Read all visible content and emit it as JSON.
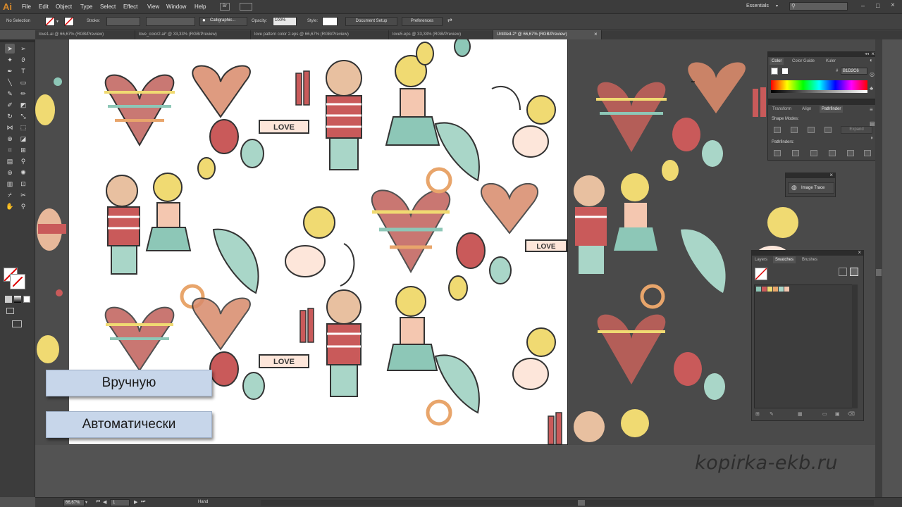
{
  "app": {
    "logo": "Ai",
    "workspace": "Essentials"
  },
  "menu": [
    "File",
    "Edit",
    "Object",
    "Type",
    "Select",
    "Effect",
    "View",
    "Window",
    "Help"
  ],
  "control_bar": {
    "selection": "No Selection",
    "stroke_label": "Stroke:",
    "brush_name": "Calligraphic...",
    "opacity_label": "Opacity:",
    "opacity_value": "100%",
    "style_label": "Style:",
    "document_setup": "Document Setup",
    "preferences": "Preferences",
    "br_label": "Br"
  },
  "doc_tabs": [
    "love1.ai @ 66,67% (RGB/Preview)",
    "love_color2.ai* @ 33,33% (RGB/Preview)",
    "love pattern color 2.eps @ 66,67% (RGB/Preview)",
    "love5.eps @ 33,33% (RGB/Preview)",
    "Untitled-2* @ 66,67% (RGB/Preview)"
  ],
  "labels": {
    "manual": "Вручную",
    "auto": "Автоматически"
  },
  "doodles": {
    "love1": "LOVE",
    "love2": "LOVE",
    "love3": "LOVE",
    "love4": "LOVE"
  },
  "color_panel": {
    "tabs": [
      "Color",
      "Color Guide",
      "Kuler"
    ],
    "hex_label": "#",
    "hex": "B1D2C6"
  },
  "transform_panel": {
    "tabs": [
      "Transform",
      "Align",
      "Pathfinder"
    ],
    "shape_modes": "Shape Modes:",
    "expand": "Expand",
    "pathfinders": "Pathfinders:"
  },
  "image_trace": {
    "label": "Image Trace"
  },
  "layers_panel": {
    "tabs": [
      "Layers",
      "Swatches",
      "Brushes"
    ]
  },
  "status": {
    "zoom": "66,67%",
    "artboard": "1",
    "tool": "Hand"
  },
  "watermark": "kopirka-ekb.ru",
  "colors": {
    "accent": "#d88a2b",
    "label_bg": "#c7d6ea",
    "canvas": "#535353"
  }
}
